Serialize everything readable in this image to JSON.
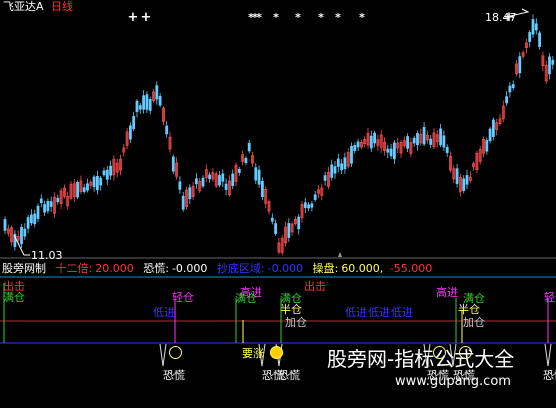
{
  "header": {
    "stock_name": "飞亚达A",
    "period": "日线"
  },
  "price_panel": {
    "high_label": "18.47",
    "low_label": "11.03",
    "colors": {
      "up": "#ff4d4d",
      "down": "#66ccff",
      "marker": "#ffffff"
    }
  },
  "indicator_bar": {
    "name": "股旁网制",
    "items": [
      {
        "label": "十二倍:",
        "value": "20.000",
        "color": "#ff3333"
      },
      {
        "label": "恐慌:",
        "value": "-0.000",
        "color": "#ffffff"
      },
      {
        "label": "抄底区域:",
        "value": "-0.000",
        "color": "#3333ff"
      },
      {
        "label": "操盘:",
        "value": "60.000,",
        "extra": "-55.000",
        "color": "#ffff66",
        "extra_color": "#ff3333"
      }
    ]
  },
  "signals": {
    "chu_ji": "出击",
    "qing_cang": "轻仓",
    "man_cang": "满仓",
    "gao_jin": "高进",
    "ban_cang": "半仓",
    "jia_cang": "加仓",
    "di_jin": "低进",
    "yao_zhang": "要涨",
    "kong_huang": "恐慌"
  },
  "watermark": {
    "text": "股旁网-指标公式大全",
    "url": "www.gupang.com"
  }
}
